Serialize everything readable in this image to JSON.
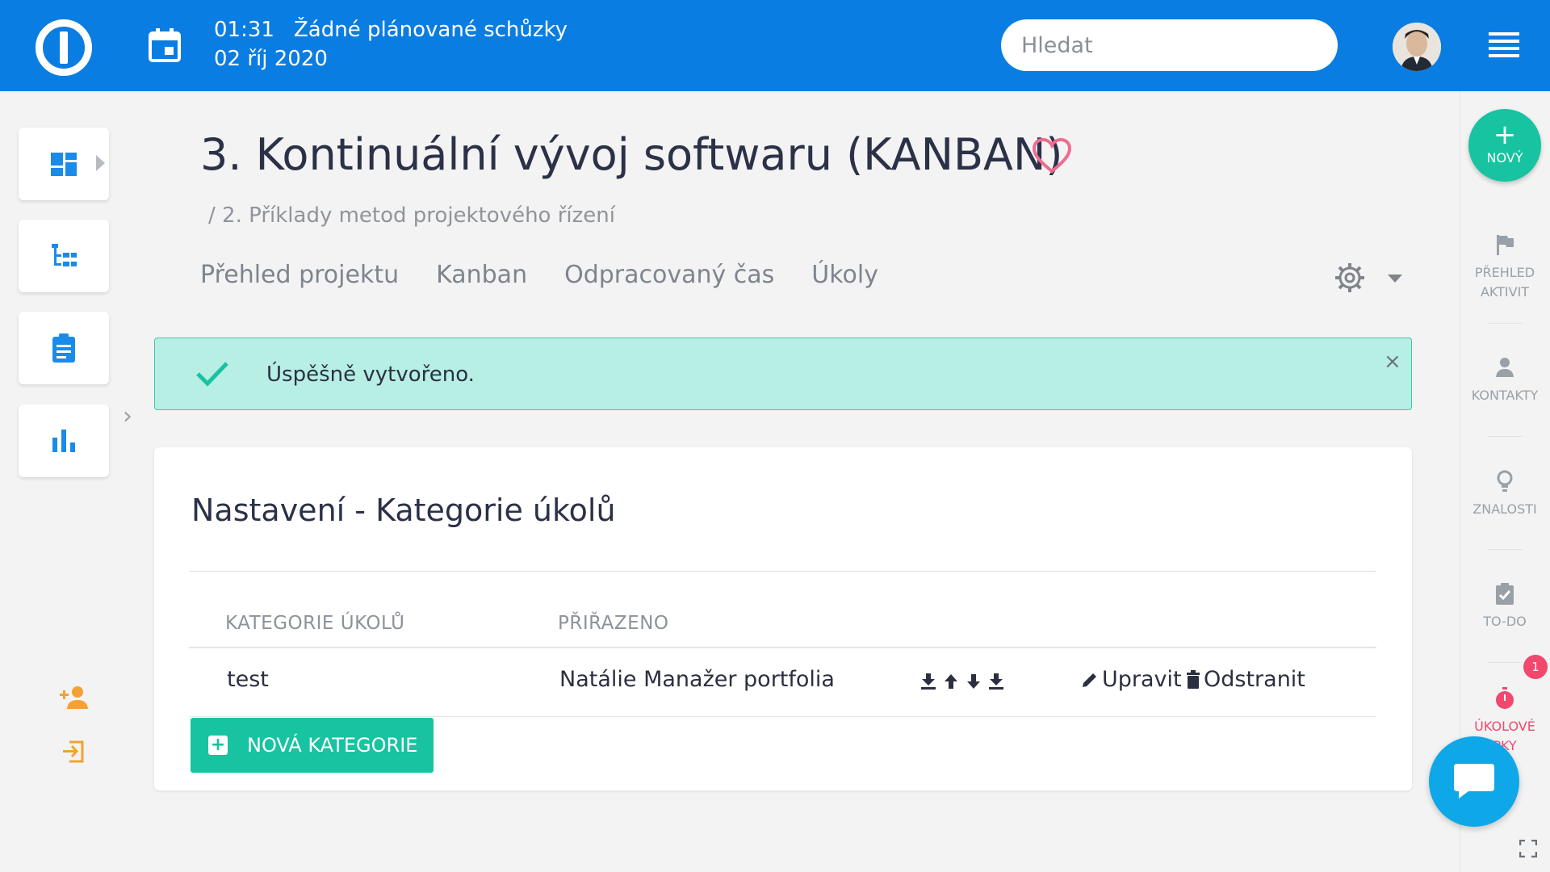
{
  "header": {
    "time": "01:31",
    "meeting_text": "Žádné plánované schůzky",
    "date": "02 říj 2020",
    "search_placeholder": "Hledat"
  },
  "page": {
    "title": "3. Kontinuální vývoj softwaru (KANBAN)",
    "breadcrumb": "/ 2. Příklady metod projektového řízení",
    "tabs": [
      "Přehled projektu",
      "Kanban",
      "Odpracovaný čas",
      "Úkoly"
    ]
  },
  "alert": {
    "message": "Úspěšně vytvořeno.",
    "close": "×"
  },
  "settings_card": {
    "title": "Nastavení - Kategorie úkolů",
    "columns": [
      "KATEGORIE ÚKOLŮ",
      "PŘIŘAZENO"
    ],
    "rows": [
      {
        "category": "test",
        "assigned": "Natálie Manažer portfolia"
      }
    ],
    "edit_label": "Upravit",
    "delete_label": "Odstranit",
    "new_button": "NOVÁ KATEGORIE"
  },
  "right_rail": {
    "new_label": "NOVÝ",
    "activity_label_1": "PŘEHLED",
    "activity_label_2": "AKTIVIT",
    "contacts_label": "KONTAKTY",
    "knowledge_label": "ZNALOSTI",
    "todo_label": "TO-DO",
    "timers_label_1": "ÚKOLOVÉ",
    "timers_label_2": "PKY",
    "timers_badge": "1"
  },
  "colors": {
    "brand_blue": "#0a7de2",
    "accent_green": "#17c3a0",
    "alert_bg": "#b7efe5",
    "heart_pink": "#f06b8e",
    "icon_blue": "#1a8be8",
    "icon_orange": "#f5a033",
    "timer_red": "#f2486e",
    "chat_blue": "#0ea7e8"
  }
}
